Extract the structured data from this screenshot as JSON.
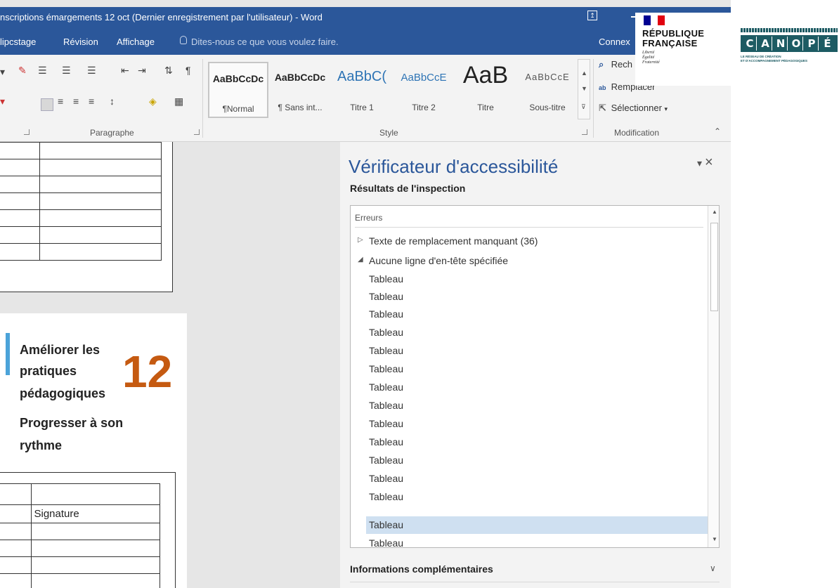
{
  "window": {
    "title": "nscriptions émargements 12 oct (Dernier enregistrement par l'utilisateur) - Word"
  },
  "menu": {
    "items": [
      "lipcstage",
      "Révision",
      "Affichage"
    ],
    "tell_me": "Dites-nous ce que vous voulez faire.",
    "connexion": "Connex"
  },
  "ribbon": {
    "groups": {
      "paragraph": "Paragraphe",
      "style": "Style",
      "modification": "Modification"
    },
    "styles": [
      {
        "sample": "AaBbCcDc",
        "name": "¶Normal"
      },
      {
        "sample": "AaBbCcDc",
        "name": "¶ Sans int..."
      },
      {
        "sample": "AaBbC(",
        "name": "Titre 1"
      },
      {
        "sample": "AaBbCcE",
        "name": "Titre 2"
      },
      {
        "sample": "AaB",
        "name": "Titre"
      },
      {
        "sample": "AaBbCcE",
        "name": "Sous-titre"
      }
    ],
    "modification_items": [
      "Rech",
      "Remplacer",
      "Sélectionner"
    ],
    "style_colors": {
      "normal": "#222222",
      "heading": "#2e74b5"
    }
  },
  "document": {
    "heading_lines": [
      "Améliorer les",
      "pratiques",
      "pédagogiques"
    ],
    "subheading_lines": [
      "Progresser à son",
      "rythme"
    ],
    "number": "12",
    "table_header": "Signature",
    "accent_color": "#c55a11"
  },
  "pane": {
    "title": "Vérificateur d'accessibilité",
    "subtitle": "Résultats de l'inspection",
    "section_header": "Erreurs",
    "groups": [
      {
        "label": "Texte de remplacement manquant (36)",
        "expanded": false
      },
      {
        "label": "Aucune ligne d'en-tête spécifiée",
        "expanded": true
      }
    ],
    "items": [
      "Tableau",
      "Tableau",
      "Tableau",
      "Tableau",
      "Tableau",
      "Tableau",
      "Tableau",
      "Tableau",
      "Tableau",
      "Tableau",
      "Tableau",
      "Tableau",
      "Tableau",
      "Tableau",
      "Tableau"
    ],
    "selected_index": 13,
    "more_info": "Informations complémentaires"
  },
  "logos": {
    "republique": {
      "line1": "RÉPUBLIQUE",
      "line2": "FRANÇAISE",
      "motto": [
        "Liberté",
        "Égalité",
        "Fraternité"
      ]
    },
    "canope": {
      "letters": [
        "C",
        "A",
        "N",
        "O",
        "P",
        "É"
      ],
      "tagline1": "LE RÉSEAU DE CRÉATION",
      "tagline2": "ET D'ACCOMPAGNEMENT PÉDAGOGIQUES"
    }
  },
  "colors": {
    "word_blue": "#2b579a",
    "selection": "#cfe0f1",
    "canope_teal": "#1d5b63"
  }
}
